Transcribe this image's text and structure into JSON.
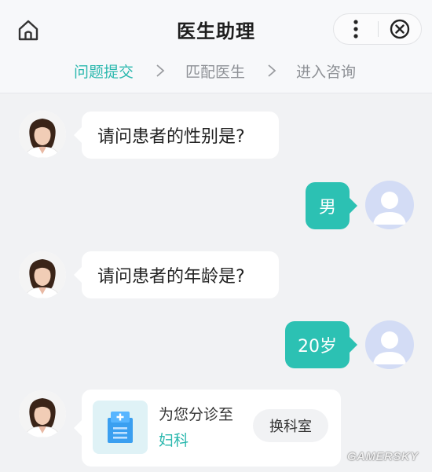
{
  "header": {
    "title": "医生助理",
    "home_icon": "home-icon",
    "more_icon": "more-vertical-icon",
    "close_icon": "close-circle-icon"
  },
  "steps": [
    {
      "label": "问题提交",
      "state": "active"
    },
    {
      "label": "匹配医生",
      "state": "inactive"
    },
    {
      "label": "进入咨询",
      "state": "inactive"
    }
  ],
  "messages": [
    {
      "from": "doctor",
      "text": "请问患者的性别是?"
    },
    {
      "from": "user",
      "text": "男"
    },
    {
      "from": "doctor",
      "text": "请问患者的年龄是?"
    },
    {
      "from": "user",
      "text": "20岁"
    }
  ],
  "department_card": {
    "prefix": "为您分诊至",
    "department": "妇科",
    "change_label": "换科室",
    "icon": "hospital-building-icon"
  },
  "watermark": "GAMERSKY",
  "colors": {
    "accent": "#2bb8ae",
    "user_bubble": "#2cc1b3",
    "background": "#f1f2f4",
    "user_avatar": "#d3dcf5"
  }
}
